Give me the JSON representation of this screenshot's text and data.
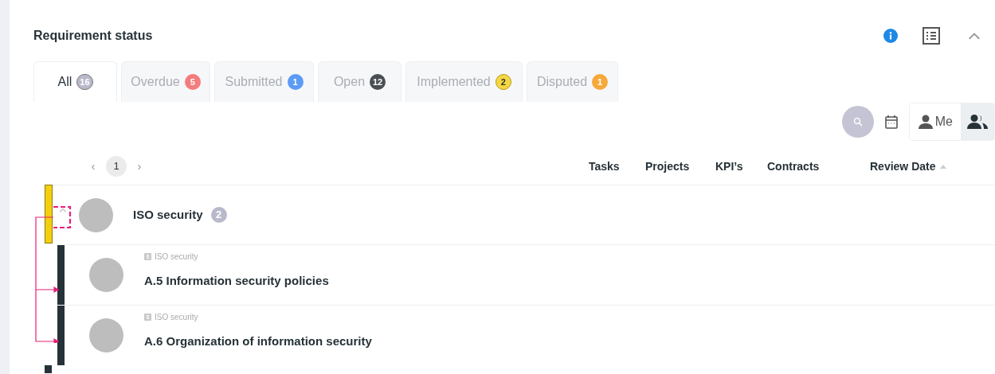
{
  "title": "Requirement status",
  "tabs": [
    {
      "label": "All",
      "count": "16",
      "color": "#b9b9cc",
      "selected": true
    },
    {
      "label": "Overdue",
      "count": "5",
      "color": "#f47c7c",
      "selected": false
    },
    {
      "label": "Submitted",
      "count": "1",
      "color": "#5b9bf5",
      "selected": false
    },
    {
      "label": "Open",
      "count": "12",
      "color": "#4a4f54",
      "selected": false
    },
    {
      "label": "Implemented",
      "count": "2",
      "color": "#f5d742",
      "selected": false
    },
    {
      "label": "Disputed",
      "count": "1",
      "color": "#f6a93b",
      "selected": false
    }
  ],
  "filters": {
    "me_label": "Me",
    "me_selected": false,
    "team_selected": true
  },
  "pager": {
    "prev": "‹",
    "page": "1",
    "next": "›"
  },
  "columns": [
    "Tasks",
    "Projects",
    "KPI’s",
    "Contracts",
    "Review Date"
  ],
  "groups": [
    {
      "title": "ISO security",
      "count": "2",
      "color": "#f5cf0f",
      "expanded": true,
      "children": [
        {
          "category": "ISO security",
          "title": "A.5 Information security policies",
          "color": "#263238"
        },
        {
          "category": "ISO security",
          "title": "A.6 Organization of information security",
          "color": "#263238"
        }
      ]
    }
  ]
}
